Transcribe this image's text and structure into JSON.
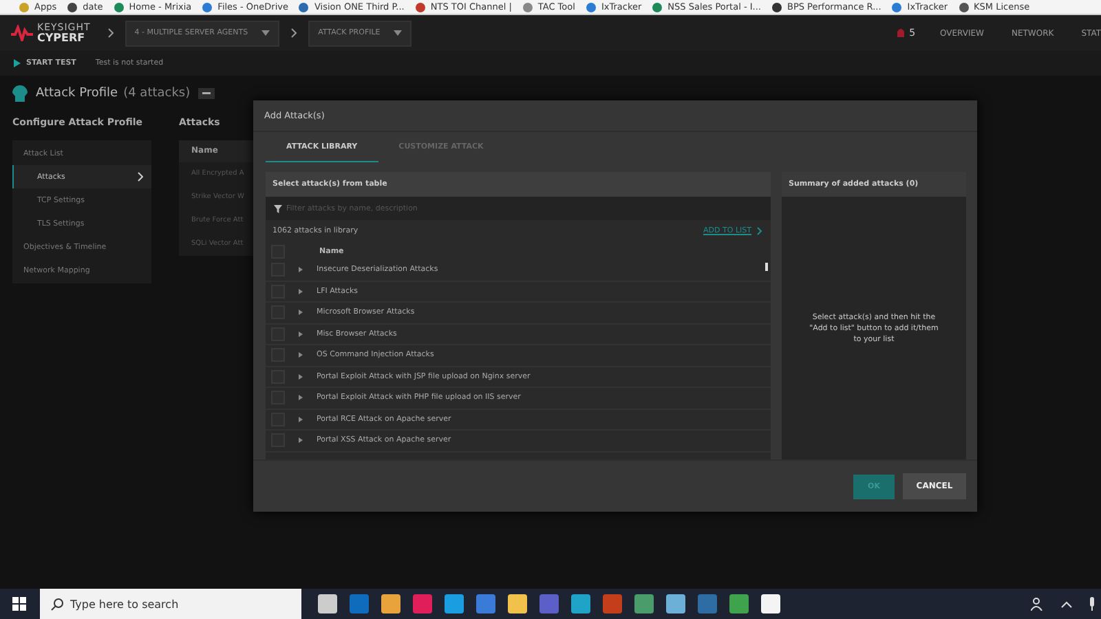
{
  "bookmarks": [
    {
      "label": "Apps"
    },
    {
      "label": "date"
    },
    {
      "label": "Home - Mrixia"
    },
    {
      "label": "Files - OneDrive"
    },
    {
      "label": "Vision ONE Third P..."
    },
    {
      "label": "NTS TOI Channel |"
    },
    {
      "label": "TAC Tool"
    },
    {
      "label": "IxTracker"
    },
    {
      "label": "NSS Sales Portal - I..."
    },
    {
      "label": "BPS Performance R..."
    },
    {
      "label": "IxTracker"
    },
    {
      "label": "KSM License"
    }
  ],
  "header": {
    "logo_top": "KEYSIGHT",
    "logo_bottom": "CYPERF",
    "breadcrumbs": [
      {
        "label": "4 - MULTIPLE SERVER AGENTS"
      },
      {
        "label": "ATTACK PROFILE"
      }
    ],
    "alerts": "5",
    "nav": [
      {
        "label": "OVERVIEW"
      },
      {
        "label": "NETWORK"
      },
      {
        "label": "STAT"
      }
    ]
  },
  "toolbar": {
    "start": "START TEST",
    "status": "Test is not started"
  },
  "page": {
    "title": "Attack Profile",
    "count": "(4 attacks)"
  },
  "sidebar": {
    "title": "Configure Attack Profile",
    "items": [
      {
        "label": "Attack List",
        "selected": false,
        "children": [
          {
            "label": "Attacks",
            "selected": true
          },
          {
            "label": "TCP Settings",
            "selected": false
          },
          {
            "label": "TLS Settings",
            "selected": false
          }
        ]
      },
      {
        "label": "Objectives & Timeline",
        "selected": false
      },
      {
        "label": "Network Mapping",
        "selected": false
      }
    ]
  },
  "attacks_panel": {
    "title": "Attacks",
    "column": "Name",
    "rows": [
      "All Encrypted A",
      "Strike Vector W",
      "Brute Force Att",
      "SQLi Vector Att"
    ]
  },
  "dialog": {
    "title": "Add Attack(s)",
    "tabs": [
      {
        "label": "ATTACK LIBRARY",
        "selected": true
      },
      {
        "label": "CUSTOMIZE ATTACK",
        "selected": false
      }
    ],
    "table_title": "Select attack(s) from table",
    "filter": {
      "placeholder": "Filter attacks by name, description"
    },
    "count": "1062 attacks in library",
    "add_link": "ADD TO LIST",
    "column": "Name",
    "select_all": {
      "checked": false
    },
    "rows": [
      {
        "name": "Insecure Deserialization Attacks",
        "checked": false
      },
      {
        "name": "LFI Attacks",
        "checked": false
      },
      {
        "name": "Microsoft Browser Attacks",
        "checked": false
      },
      {
        "name": "Misc Browser Attacks",
        "checked": false
      },
      {
        "name": "OS Command Injection Attacks",
        "checked": false
      },
      {
        "name": "Portal Exploit Attack with JSP file upload on Nginx server",
        "checked": false
      },
      {
        "name": "Portal Exploit Attack with PHP file upload on IIS server",
        "checked": false
      },
      {
        "name": "Portal RCE Attack on Apache server",
        "checked": false
      },
      {
        "name": "Portal XSS Attack on Apache server",
        "checked": false
      }
    ],
    "summary_title": "Summary of added attacks (0)",
    "summary_hint": "Select attack(s) and then hit the \"Add to list\" button to add it/them to your list",
    "ok": {
      "label": "OK",
      "disabled": true
    },
    "cancel": "CANCEL"
  },
  "taskbar": {
    "search": {
      "placeholder": "Type here to search"
    }
  }
}
